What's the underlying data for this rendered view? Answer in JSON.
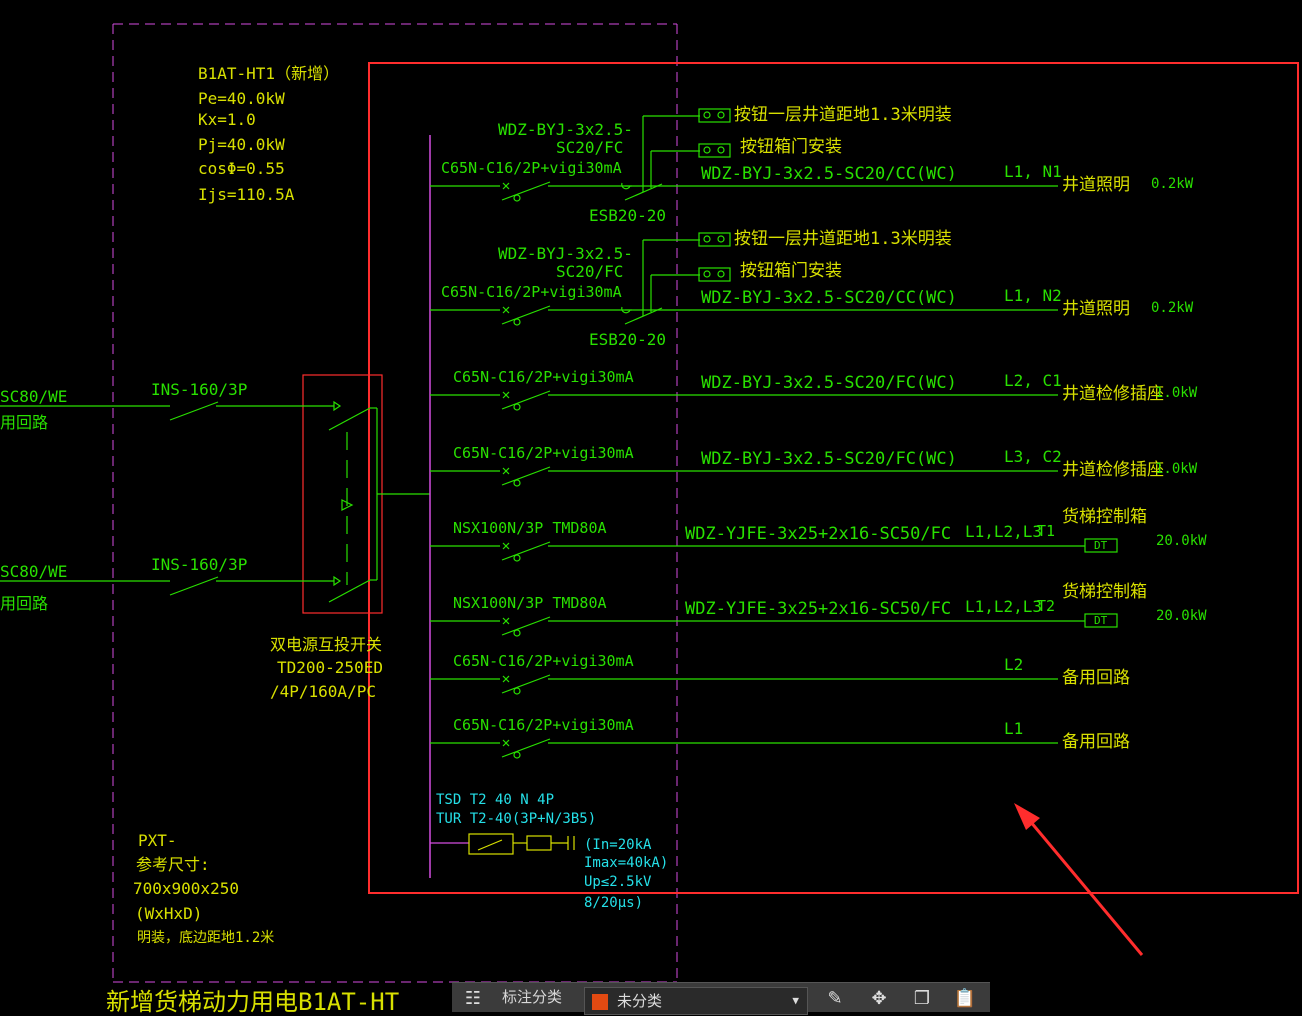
{
  "colors": {
    "yellow": "#d8e000",
    "green": "#29e000",
    "cyan": "#25e0e8",
    "magenta": "#d34de0",
    "red_box": "#ff2d2d",
    "toolbar_bg": "#3b3b3b"
  },
  "panel": {
    "name": "B1AT-HT1（新增）",
    "pe": "Pe=40.0kW",
    "kx": "Kx=1.0",
    "pj": "Pj=40.0kW",
    "cos": "cosΦ=0.55",
    "ijs": "Ijs=110.5A"
  },
  "inputs": [
    {
      "cable": "SC80/WE",
      "desc": "用回路",
      "breaker": "INS-160/3P"
    },
    {
      "cable": "SC80/WE",
      "desc": "用回路",
      "breaker": "INS-160/3P"
    }
  ],
  "ats": {
    "l1": "双电源互投开关",
    "l2": "TD200-250ED",
    "l3": "/4P/160A/PC"
  },
  "box": {
    "l1": "PXT-",
    "l2": "参考尺寸:",
    "l3": "700x900x250",
    "l4": "(WxHxD)",
    "l5": "明装，底边距地1.2米"
  },
  "circuits": [
    {
      "breaker": "C65N-C16/2P+vigi30mA",
      "cable_top": "WDZ-BYJ-3x2.5-",
      "cable_top2": "SC20/FC",
      "esb": "ESB20-20",
      "btn1": "按钮一层井道距地1.3米明装",
      "btn2": "按钮箱门安装",
      "cable": "WDZ-BYJ-3x2.5-SC20/CC(WC)",
      "phase": "L1, N1",
      "load": "井道照明",
      "power": "0.2kW"
    },
    {
      "breaker": "C65N-C16/2P+vigi30mA",
      "cable_top": "WDZ-BYJ-3x2.5-",
      "cable_top2": "SC20/FC",
      "esb": "ESB20-20",
      "btn1": "按钮一层井道距地1.3米明装",
      "btn2": "按钮箱门安装",
      "cable": "WDZ-BYJ-3x2.5-SC20/CC(WC)",
      "phase": "L1, N2",
      "load": "井道照明",
      "power": "0.2kW"
    },
    {
      "breaker": "C65N-C16/2P+vigi30mA",
      "cable": "WDZ-BYJ-3x2.5-SC20/FC(WC)",
      "phase": "L2, C1",
      "load": "井道检修插座",
      "power": "1.0kW"
    },
    {
      "breaker": "C65N-C16/2P+vigi30mA",
      "cable": "WDZ-BYJ-3x2.5-SC20/FC(WC)",
      "phase": "L3, C2",
      "load": "井道检修插座",
      "power": "1.0kW"
    },
    {
      "breaker": "NSX100N/3P  TMD80A",
      "cable": "WDZ-YJFE-3x25+2x16-SC50/FC",
      "phase": "L1,L2,L3",
      "tag": "T1",
      "load": "货梯控制箱",
      "dt": "DT",
      "power": "20.0kW"
    },
    {
      "breaker": "NSX100N/3P  TMD80A",
      "cable": "WDZ-YJFE-3x25+2x16-SC50/FC",
      "phase": "L1,L2,L3",
      "tag": "T2",
      "load": "货梯控制箱",
      "dt": "DT",
      "power": "20.0kW"
    },
    {
      "breaker": "C65N-C16/2P+vigi30mA",
      "phase": "L2",
      "load": "备用回路"
    },
    {
      "breaker": "C65N-C16/2P+vigi30mA",
      "phase": "L1",
      "load": "备用回路"
    }
  ],
  "spd": {
    "l1": "TSD T2 40 N 4P",
    "l2": "TUR T2-40(3P+N/3B5)",
    "l3": "(In=20kA",
    "l4": "Imax=40kA)",
    "l5": "Up≤2.5kV",
    "l6": "8/20μs)"
  },
  "bottom_title": "新增货梯动力用电B1AT-HT",
  "toolbar": {
    "grid_icon": "grid-icon",
    "label": "标注分类",
    "category": "未分类",
    "category_color": "#e24a12",
    "tools": [
      "edit-icon",
      "move-icon",
      "copy-icon",
      "paste-icon"
    ]
  }
}
